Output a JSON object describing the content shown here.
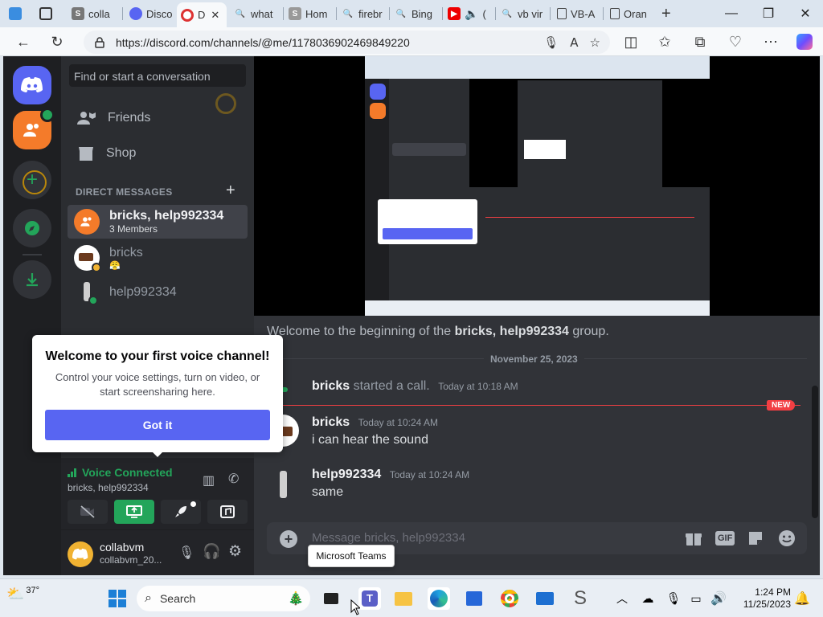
{
  "browser": {
    "tabs": [
      {
        "label": "",
        "icon": "browser-window-icon"
      },
      {
        "label": "",
        "icon": "tab-actions-icon"
      },
      {
        "label": "colla",
        "icon": "s-logo-icon"
      },
      {
        "label": "Disco",
        "icon": "discord-icon"
      },
      {
        "label": "D",
        "icon": "record-icon",
        "active": true
      },
      {
        "label": "what",
        "icon": "search-icon"
      },
      {
        "label": "Hom",
        "icon": "s-logo-icon"
      },
      {
        "label": "firebr",
        "icon": "search-icon"
      },
      {
        "label": "Bing",
        "icon": "search-icon"
      },
      {
        "label": "(",
        "icon": "youtube-icon"
      },
      {
        "label": "vb vir",
        "icon": "search-icon"
      },
      {
        "label": "VB-A",
        "icon": "page-icon"
      },
      {
        "label": "Oran",
        "icon": "page-icon"
      }
    ],
    "url": "https://discord.com/channels/@me/1178036902469849220"
  },
  "discord": {
    "search_placeholder": "Find or start a conversation",
    "nav": {
      "friends": "Friends",
      "shop": "Shop"
    },
    "dm_header": "DIRECT MESSAGES",
    "dms": [
      {
        "name": "bricks, help992334",
        "sub": "3 Members",
        "active": true
      },
      {
        "name": "bricks",
        "sub": "",
        "active": false
      },
      {
        "name": "help992334",
        "sub": "",
        "active": false
      }
    ],
    "popup": {
      "title": "Welcome to your first voice channel!",
      "body": "Control your voice settings, turn on video, or start screensharing here.",
      "button": "Got it"
    },
    "voice": {
      "status": "Voice Connected",
      "channel": "bricks, help992334"
    },
    "user": {
      "name": "collabvm",
      "status": "collabvm_20..."
    },
    "chat": {
      "welcome_prefix": "Welcome to the beginning of the ",
      "welcome_group": "bricks, help992334",
      "welcome_suffix": " group.",
      "date": "November 25, 2023",
      "call": {
        "author": "bricks",
        "text": "started a call.",
        "time": "Today at 10:18 AM"
      },
      "new_badge": "NEW",
      "messages": [
        {
          "author": "bricks",
          "time": "Today at 10:24 AM",
          "text": "i can hear the sound"
        },
        {
          "author": "help992334",
          "time": "Today at 10:24 AM",
          "text": "same"
        }
      ],
      "composer_placeholder": "Message bricks, help992334",
      "gif_label": "GIF"
    }
  },
  "tooltip": "Microsoft Teams",
  "taskbar": {
    "weather": "37°",
    "search_label": "Search",
    "time": "1:24 PM",
    "date": "11/25/2023"
  },
  "colors": {
    "blurple": "#5865f2",
    "green": "#23a55a",
    "red": "#f23f43"
  }
}
